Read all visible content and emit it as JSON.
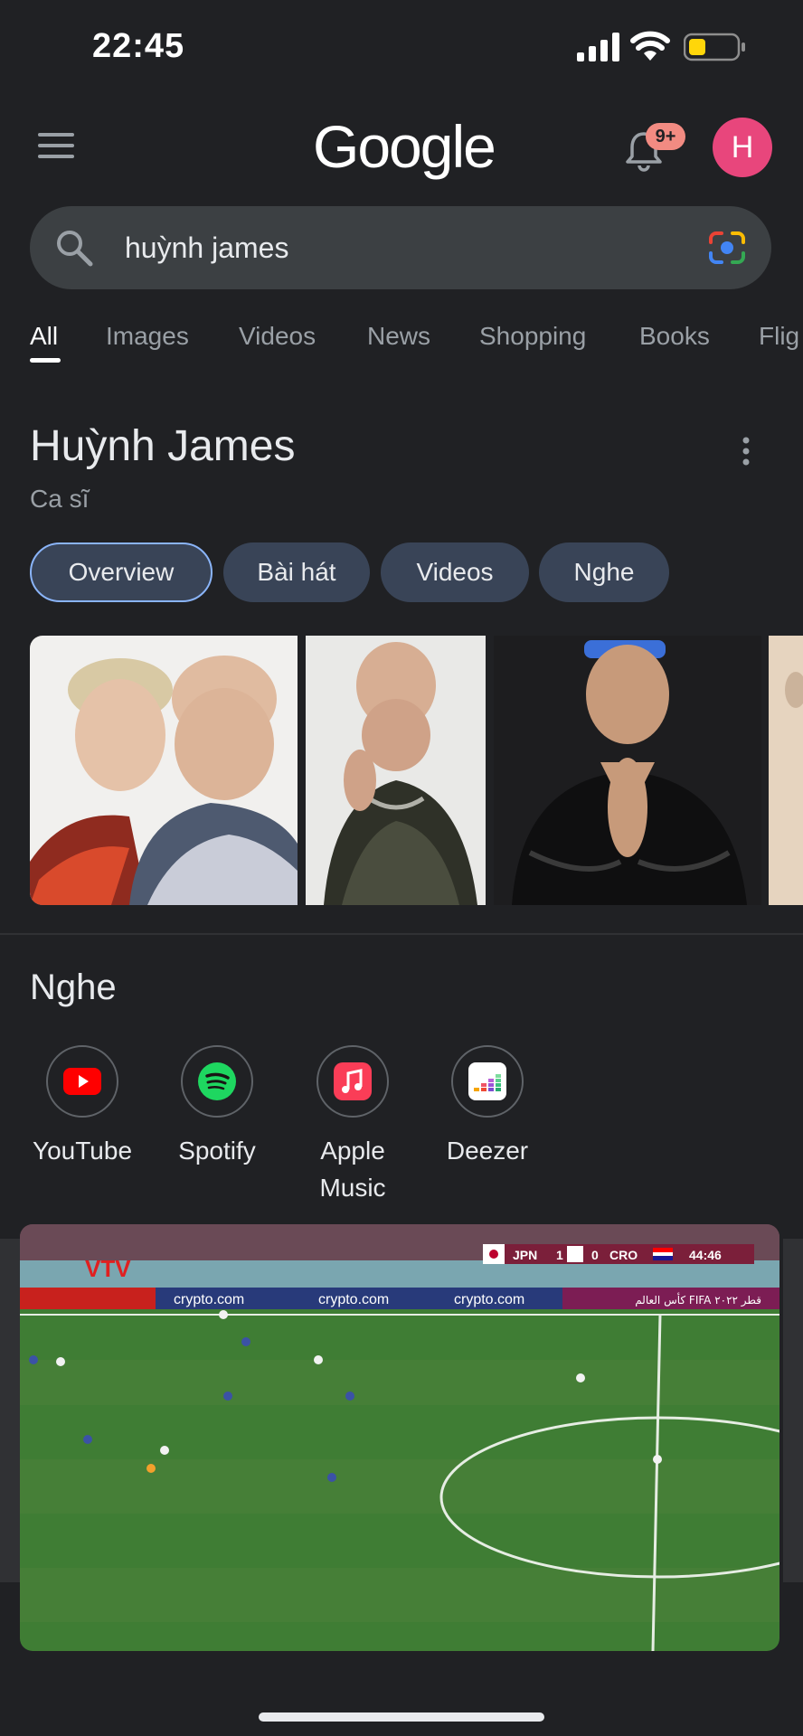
{
  "status_bar": {
    "time": "22:45"
  },
  "header": {
    "logo": "Google",
    "notification_badge": "9+",
    "avatar_letter": "H"
  },
  "search": {
    "query": "huỳnh james"
  },
  "tabs": [
    "All",
    "Images",
    "Videos",
    "News",
    "Shopping",
    "Books",
    "Flig"
  ],
  "entity": {
    "title": "Huỳnh James",
    "subtitle": "Ca sĩ",
    "chips": [
      "Overview",
      "Bài hát",
      "Videos",
      "Nghe"
    ]
  },
  "listen": {
    "title": "Nghe",
    "services": [
      {
        "label": "YouTube",
        "icon": "youtube-icon"
      },
      {
        "label": "Spotify",
        "icon": "spotify-icon"
      },
      {
        "label": "Apple Music",
        "icon": "apple-music-icon"
      },
      {
        "label": "Deezer",
        "icon": "deezer-icon"
      }
    ]
  },
  "video": {
    "channel_logo": "VTV",
    "scoreboard": {
      "team1": "JPN",
      "score1": "1",
      "score2": "0",
      "team2": "CRO",
      "clock": "44:46"
    },
    "ad_text": "crypto.com",
    "banner_arabic": "كأس العالم FIFA قطر ٢٠٢٢"
  },
  "colors": {
    "background": "#202124",
    "accent": "#8ab4f8",
    "avatar": "#e8467c",
    "badge": "#f28b82"
  }
}
